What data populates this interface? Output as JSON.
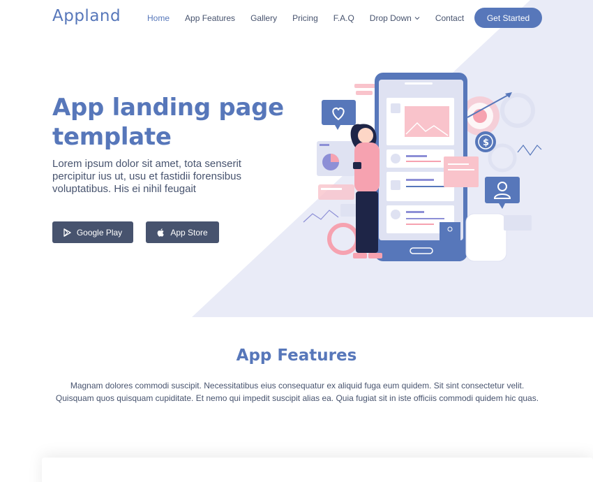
{
  "header": {
    "logo": "Appland",
    "nav": [
      {
        "label": "Home",
        "active": true
      },
      {
        "label": "App Features"
      },
      {
        "label": "Gallery"
      },
      {
        "label": "Pricing"
      },
      {
        "label": "F.A.Q"
      },
      {
        "label": "Drop Down",
        "has_dropdown": true
      },
      {
        "label": "Contact"
      }
    ],
    "cta_label": "Get Started"
  },
  "hero": {
    "title": "App landing page template",
    "subtitle": "Lorem ipsum dolor sit amet, tota senserit percipitur ius ut, usu et fastidii forensibus voluptatibus. His ei nihil feugait",
    "google_play_label": "Google Play",
    "app_store_label": "App Store"
  },
  "features": {
    "title": "App Features",
    "description": "Magnam dolores commodi suscipit. Necessitatibus eius consequatur ex aliquid fuga eum quidem. Sit sint consectetur velit. Quisquam quos quisquam cupiditate. Et nemo qui impedit suscipit alias ea. Quia fugiat sit in iste officiis commodi quidem hic quas."
  },
  "icons": {
    "google_play": "play-store-icon",
    "app_store": "apple-icon",
    "dropdown": "chevron-down-icon"
  },
  "colors": {
    "accent": "#5777ba",
    "text": "#47536e",
    "hero_bg": "#e9ebf7",
    "pink": "#f9c3cb"
  }
}
